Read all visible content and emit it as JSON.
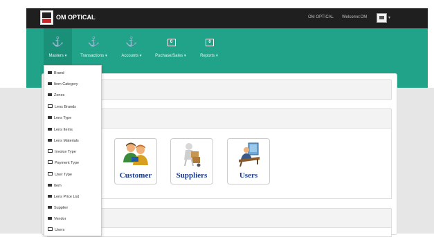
{
  "header": {
    "brand": "OM OPTICAL",
    "store_name": "OM OPTICAL",
    "welcome": "Welcome:OM",
    "caret": "▾",
    "home_icon": "⌂"
  },
  "menu": {
    "items": [
      {
        "label": "Masters ▾",
        "icon": "anchor-icon",
        "glyph": "⚓"
      },
      {
        "label": "Transactions ▾",
        "icon": "anchor-icon",
        "glyph": "⚓"
      },
      {
        "label": "Accounts ▾",
        "icon": "anchor-icon",
        "glyph": "⚓"
      },
      {
        "label": "Puchase/Sales ▾",
        "icon": "money-icon",
        "glyph": "0"
      },
      {
        "label": "Reports ▾",
        "icon": "money-icon",
        "glyph": "0"
      }
    ]
  },
  "masters_menu": {
    "items": [
      {
        "label": "Brand",
        "icon": "list-icon"
      },
      {
        "label": "Item Category",
        "icon": "list-icon"
      },
      {
        "label": "Zones",
        "icon": "list-icon"
      },
      {
        "label": "Lens Brands",
        "icon": "money-icon"
      },
      {
        "label": "Lens Type",
        "icon": "list-icon"
      },
      {
        "label": "Lens Items",
        "icon": "list-icon"
      },
      {
        "label": "Lens Materials",
        "icon": "list-icon"
      },
      {
        "label": "Invoice Type",
        "icon": "money-icon"
      },
      {
        "label": "Payment Type",
        "icon": "money-icon"
      },
      {
        "label": "User Type",
        "icon": "money-icon"
      },
      {
        "label": "Item",
        "icon": "list-icon"
      },
      {
        "label": "Lens Price List",
        "icon": "list-icon"
      },
      {
        "label": "Supplier",
        "icon": "list-icon"
      },
      {
        "label": "Vendor",
        "icon": "list-icon"
      },
      {
        "label": "Users",
        "icon": "money-icon"
      }
    ]
  },
  "tiles": [
    {
      "label": "Customer",
      "icon": "customer-icon"
    },
    {
      "label": "Suppliers",
      "icon": "supplier-icon"
    },
    {
      "label": "Users",
      "icon": "users-icon"
    }
  ],
  "colors": {
    "navbar": "#1f1f1f",
    "menubar": "#20a388",
    "tile_label": "#1a3a8a"
  }
}
